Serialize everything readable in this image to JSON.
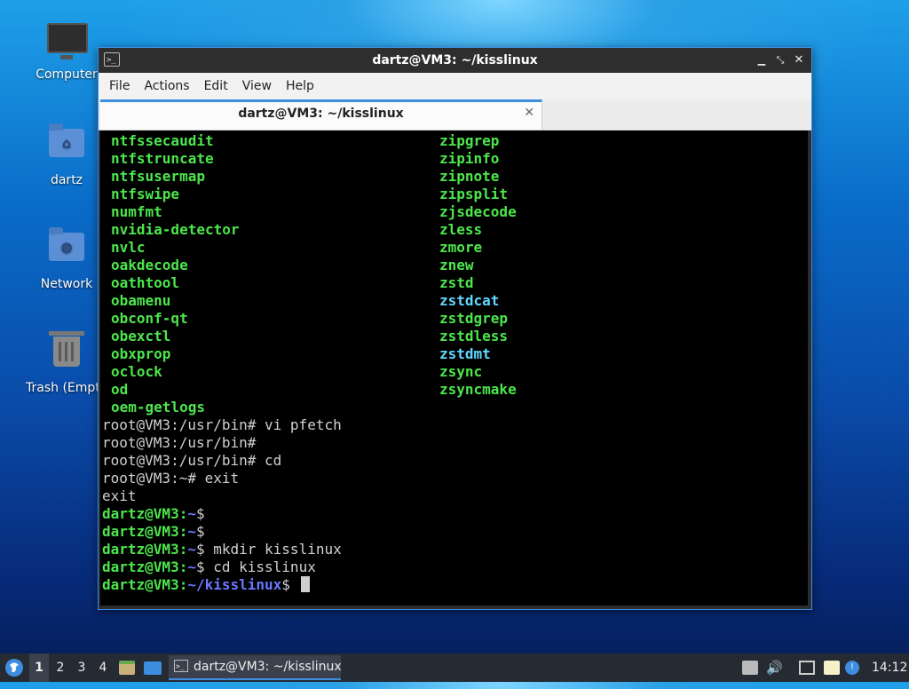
{
  "desktop": {
    "icons": [
      {
        "label": "Computer",
        "icon": "computer-icon"
      },
      {
        "label": "dartz",
        "icon": "home-folder-icon"
      },
      {
        "label": "Network",
        "icon": "network-folder-icon"
      },
      {
        "label": "Trash (Empt",
        "icon": "trash-icon"
      }
    ]
  },
  "window": {
    "title": "dartz@VM3: ~/kisslinux",
    "menu": [
      "File",
      "Actions",
      "Edit",
      "View",
      "Help"
    ],
    "tab_label": "dartz@VM3: ~/kisslinux",
    "tab_close": "✕"
  },
  "terminal": {
    "listing": [
      {
        "left": "ntfssecaudit",
        "right": "zipgrep"
      },
      {
        "left": "ntfstruncate",
        "right": "zipinfo"
      },
      {
        "left": "ntfsusermap",
        "right": "zipnote"
      },
      {
        "left": "ntfswipe",
        "right": "zipsplit"
      },
      {
        "left": "numfmt",
        "right": "zjsdecode"
      },
      {
        "left": "nvidia-detector",
        "right": "zless"
      },
      {
        "left": "nvlc",
        "right": "zmore"
      },
      {
        "left": "oakdecode",
        "right": "znew"
      },
      {
        "left": "oathtool",
        "right": "zstd"
      },
      {
        "left": "obamenu",
        "right": "zstdcat",
        "right_color": "cyan"
      },
      {
        "left": "obconf-qt",
        "right": "zstdgrep"
      },
      {
        "left": "obexctl",
        "right": "zstdless"
      },
      {
        "left": "obxprop",
        "right": "zstdmt",
        "right_color": "cyan"
      },
      {
        "left": "oclock",
        "right": "zsync"
      },
      {
        "left": "od",
        "right": "zsyncmake"
      },
      {
        "left": "oem-getlogs",
        "right": ""
      }
    ],
    "lines": [
      {
        "text": "root@VM3:/usr/bin# vi pfetch"
      },
      {
        "text": "root@VM3:/usr/bin#"
      },
      {
        "text": "root@VM3:/usr/bin# cd"
      },
      {
        "text": "root@VM3:~# exit"
      },
      {
        "text": "exit"
      }
    ],
    "prompts": [
      {
        "user": "dartz@VM3",
        "path": "~",
        "cmd": ""
      },
      {
        "user": "dartz@VM3",
        "path": "~",
        "cmd": ""
      },
      {
        "user": "dartz@VM3",
        "path": "~",
        "cmd": " mkdir kisslinux"
      },
      {
        "user": "dartz@VM3",
        "path": "~",
        "cmd": " cd kisslinux"
      },
      {
        "user": "dartz@VM3",
        "path": "~/kisslinux",
        "cmd": " "
      }
    ],
    "colors": {
      "green": "#4ce64c",
      "cyan": "#5fd7ff",
      "blue": "#6b78ff"
    }
  },
  "taskbar": {
    "workspaces": [
      "1",
      "2",
      "3",
      "4"
    ],
    "active_workspace": "1",
    "task_label": "dartz@VM3: ~/kisslinux",
    "clock": "14:12"
  }
}
